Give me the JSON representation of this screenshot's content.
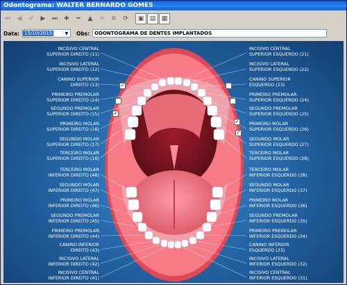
{
  "window": {
    "title": "Odontograma: WALTER BERNARDO GOMES"
  },
  "toolbar": {
    "items": [
      "first",
      "prev",
      "check",
      "next",
      "last",
      "add",
      "remove",
      "up",
      "cancel",
      "delete",
      "refresh",
      "save",
      "print",
      "edit"
    ]
  },
  "form": {
    "date_label": "Data:",
    "date_value": "15/10/2015",
    "obs_label": "Obs:",
    "obs_value": "ODONTOGRAMA DE DENTES IMPLANTADOS"
  },
  "teeth_left": [
    {
      "l1": "Incisivo Central",
      "l2": "Superior Direito (11)"
    },
    {
      "l1": "Incisivo Lateral",
      "l2": "Superior Direito (12)"
    },
    {
      "l1": "Canino Superior",
      "l2": "Direito (13)"
    },
    {
      "l1": "Primeiro Premolar",
      "l2": "Superior Direito (14)"
    },
    {
      "l1": "Segundo Premolar",
      "l2": "Superior Direito (15)"
    },
    {
      "l1": "Primeiro Molar",
      "l2": "Superior Direito (16)"
    },
    {
      "l1": "Segundo Molar",
      "l2": "Superior Direito (17)"
    },
    {
      "l1": "Terceiro Molar",
      "l2": "Superior Direito (18)"
    },
    {
      "l1": "Terceiro Molar",
      "l2": "Inferior Direito (48)"
    },
    {
      "l1": "Segundo Molar",
      "l2": "Inferior Direito (47)"
    },
    {
      "l1": "Primeiro Molar",
      "l2": "Inferior Direito (46)"
    },
    {
      "l1": "Segundo Premolar",
      "l2": "Inferior Direito (45)"
    },
    {
      "l1": "Primeiro Premolar",
      "l2": "Inferior Direito (44)"
    },
    {
      "l1": "Canino Inferior",
      "l2": "Direito (43)"
    },
    {
      "l1": "Incisivo Lateral",
      "l2": "Inferior Direito (42)"
    },
    {
      "l1": "Incisivo Central",
      "l2": "Inferior Direito (41)"
    }
  ],
  "teeth_right": [
    {
      "l1": "Incisivo Central",
      "l2": "Superior Esquerdo (21)"
    },
    {
      "l1": "Incisivo Lateral",
      "l2": "Superior Esquerdo (22)"
    },
    {
      "l1": "Canino Superior",
      "l2": "Esquerdo (23)"
    },
    {
      "l1": "Primeiro Premolar",
      "l2": "Superior Esquerdo (24)"
    },
    {
      "l1": "Segundo Premolar",
      "l2": "Superior Esquerdo (25)"
    },
    {
      "l1": "Primeiro Molar",
      "l2": "Superior Esquerdo (26)"
    },
    {
      "l1": "Segundo Molar",
      "l2": "Superior Esquerdo (27)"
    },
    {
      "l1": "Terceiro Molar",
      "l2": "Superior Esquerdo (28)"
    },
    {
      "l1": "Terceiro Molar",
      "l2": "Inferior Esquerdo (38)"
    },
    {
      "l1": "Segundo Molar",
      "l2": "Inferior Esquerdo (37)"
    },
    {
      "l1": "Primeiro Molar",
      "l2": "Inferior Esquerdo (36)"
    },
    {
      "l1": "Segundo Premolar",
      "l2": "Inferior Esquerdo (35)"
    },
    {
      "l1": "Primeiro Premolar",
      "l2": "Inferior Esquerdo (34)"
    },
    {
      "l1": "Canino Inferior",
      "l2": "Esquerdo (33)"
    },
    {
      "l1": "Incisivo Lateral",
      "l2": "Inferior Esquerdo (32)"
    },
    {
      "l1": "Incisivo Central",
      "l2": "Inferior Esquerdo (31)"
    }
  ]
}
